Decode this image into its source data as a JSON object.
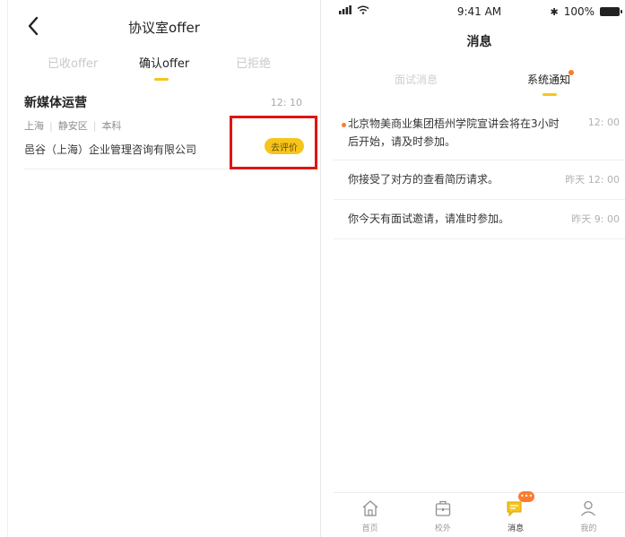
{
  "left": {
    "nav_title": "协议室offer",
    "tabs": [
      {
        "label": "已收offer"
      },
      {
        "label": "确认offer"
      },
      {
        "label": "已拒绝"
      }
    ],
    "job": {
      "title": "新媒体运营",
      "time": "12: 10",
      "meta": [
        "上海",
        "静安区",
        "本科"
      ],
      "company": "邑谷（上海）企业管理咨询有限公司",
      "action_label": "去评价"
    }
  },
  "right": {
    "status": {
      "time": "9:41 AM",
      "battery": "100%"
    },
    "title": "消息",
    "tabs": [
      {
        "label": "面试消息"
      },
      {
        "label": "系统通知"
      }
    ],
    "messages": [
      {
        "text": "北京物美商业集团梧州学院宣讲会将在3小时后开始，请及时参加。",
        "time": "12: 00"
      },
      {
        "text": "你接受了对方的查看简历请求。",
        "time": "昨天 12: 00"
      },
      {
        "text": "你今天有面试邀请，请准时参加。",
        "time": "昨天 9: 00"
      }
    ],
    "tabbar": [
      {
        "label": "首页"
      },
      {
        "label": "校外"
      },
      {
        "label": "消息",
        "badge": "•••"
      },
      {
        "label": "我的"
      }
    ]
  },
  "colors": {
    "accent": "#f6c51d",
    "notice": "#ff7a2c",
    "highlight": "#e01414"
  }
}
